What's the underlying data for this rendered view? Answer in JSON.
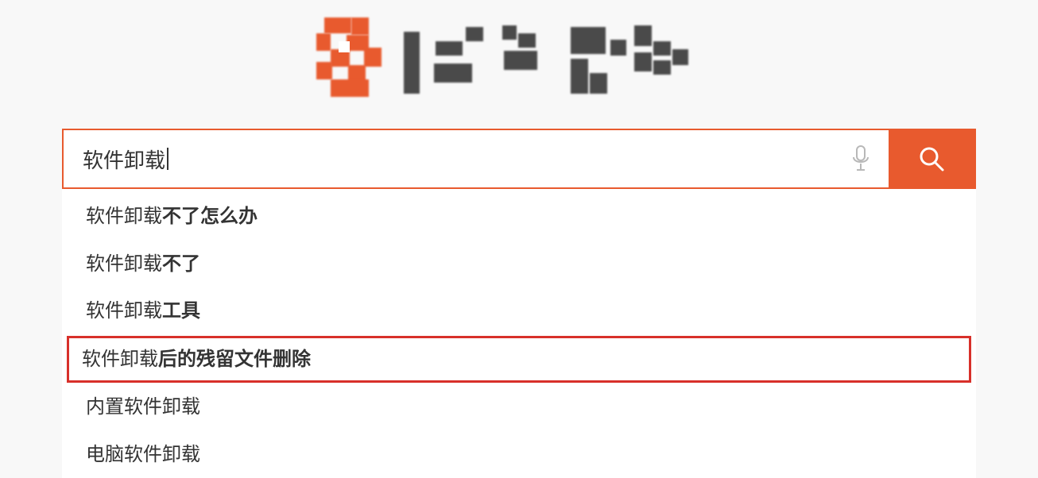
{
  "search": {
    "query": "软件卸载",
    "placeholder": ""
  },
  "suggestions": [
    {
      "prefix": "软件卸载",
      "bold": "不了怎么办",
      "highlighted": false
    },
    {
      "prefix": "软件卸载",
      "bold": "不了",
      "highlighted": false
    },
    {
      "prefix": "软件卸载",
      "bold": "工具",
      "highlighted": false
    },
    {
      "prefix": "软件卸载",
      "bold": "后的残留文件删除",
      "highlighted": true
    },
    {
      "prefix": "内置软件卸载",
      "bold": "",
      "highlighted": false
    },
    {
      "prefix": "电脑软件卸载",
      "bold": "",
      "highlighted": false
    }
  ],
  "colors": {
    "accent": "#e85a2e",
    "highlight_border": "#d8302a"
  }
}
